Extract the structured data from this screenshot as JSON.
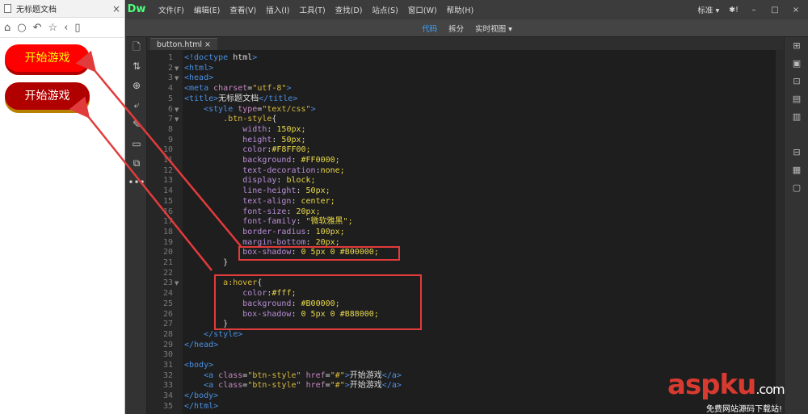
{
  "browser": {
    "tab_title": "无标题文档",
    "tab_close": "×",
    "nav_icons": [
      "home-icon",
      "reload-icon",
      "undo-icon",
      "star-icon",
      "back-icon",
      "page-icon"
    ],
    "buttons": [
      "开始游戏",
      "开始游戏"
    ]
  },
  "dw": {
    "logo": "Dw",
    "menus": [
      "文件(F)",
      "编辑(E)",
      "查看(V)",
      "插入(I)",
      "工具(T)",
      "查找(D)",
      "站点(S)",
      "窗口(W)",
      "帮助(H)"
    ],
    "workspace": "标准",
    "workspace_arrow": "▾",
    "settings": "✱!",
    "window_buttons": [
      "–",
      "□",
      "×"
    ],
    "views": {
      "code": "代码",
      "split": "拆分",
      "live": "实时视图",
      "arrow": "▾"
    },
    "file_tab": "button.html ×"
  },
  "code_lines": [
    "<!doctype html>",
    "<html>",
    "<head>",
    "<meta charset=\"utf-8\">",
    "<title>无标题文档</title>",
    "    <style type=\"text/css\">",
    "        .btn-style{",
    "            width: 150px;",
    "            height: 50px;",
    "            color:#F8FF00;",
    "            background: #FF0000;",
    "            text-decoration:none;",
    "            display: block;",
    "            line-height: 50px;",
    "            text-align: center;",
    "            font-size: 20px;",
    "            font-family: \"微软雅黑\";",
    "            border-radius: 100px;",
    "            margin-bottom: 20px;",
    "            box-shadow: 0 5px 0 #B00000;",
    "        }",
    "",
    "        a:hover{",
    "            color:#fff;",
    "            background: #B00000;",
    "            box-shadow: 0 5px 0 #B88000;",
    "        }",
    "    </style>",
    "</head>",
    "",
    "<body>",
    "    <a class=\"btn-style\" href=\"#\">开始游戏</a>",
    "    <a class=\"btn-style\" href=\"#\">开始游戏</a>",
    "</body>",
    "</html>"
  ],
  "fold_lines": [
    2,
    3,
    6,
    7,
    23
  ],
  "watermark": {
    "brand": "aspku",
    "suffix": ".com",
    "tagline": "免费网站源码下载站!"
  },
  "colors": {
    "highlight": "#e23b3b",
    "accent": "#3ea6ff",
    "button_bg": "#FF0000",
    "button_text": "#F8FF00",
    "hover_bg": "#B00000"
  }
}
